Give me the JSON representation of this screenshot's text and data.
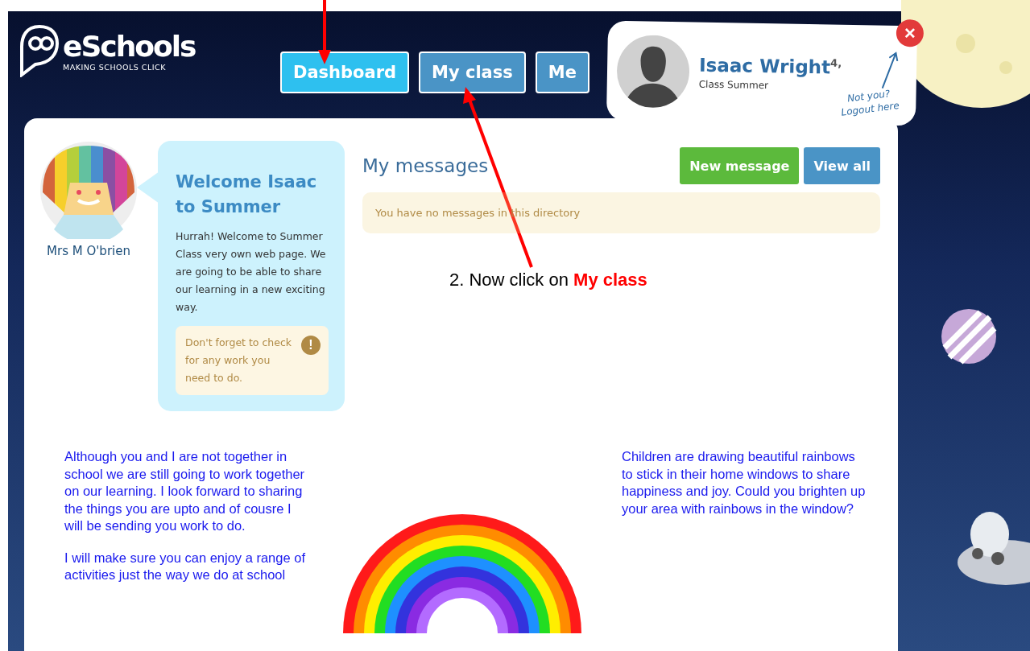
{
  "logo": {
    "name": "eSchools",
    "tagline": "MAKING SCHOOLS CLICK"
  },
  "nav_tabs": [
    {
      "label": "Dashboard",
      "selected": true
    },
    {
      "label": "My class",
      "selected": false
    },
    {
      "label": "Me",
      "selected": false
    }
  ],
  "user": {
    "name": "Isaac Wright$^{4,}$",
    "class": "Class Summer",
    "logout_hint": [
      "Not you?",
      "Logout here"
    ],
    "close": "×"
  },
  "teacher": {
    "name": "Mrs M O'brien"
  },
  "welcome": {
    "title": "Welcome Isaac to Summer",
    "body": "Hurrah! Welcome to Summer Class very own web page. We are going to be able to share our learning in a new exciting way.",
    "reminder": "Don't forget to check for any work you need to do.",
    "reminder_icon": "!"
  },
  "messages": {
    "title": "My messages",
    "buttons": [
      {
        "label": "New message",
        "kind": "primary"
      },
      {
        "label": "View all",
        "kind": "secondary"
      }
    ],
    "empty_notice": "You have no messages in this directory"
  },
  "content": {
    "left_paragraphs": [
      "Although you and I are not together in school we are still going to work together on our learning. I look forward to sharing the things you are upto and of cousre I will be sending you work to do.",
      "I will make sure you can enjoy a range of activities just the way we do at school"
    ],
    "right_paragraphs": [
      "Children are drawing beautiful rainbows to stick in their home windows to share happiness and joy. Could you brighten up your area with rainbows in the window?"
    ]
  },
  "annotation": {
    "text": "2. Now click on **My class**"
  }
}
